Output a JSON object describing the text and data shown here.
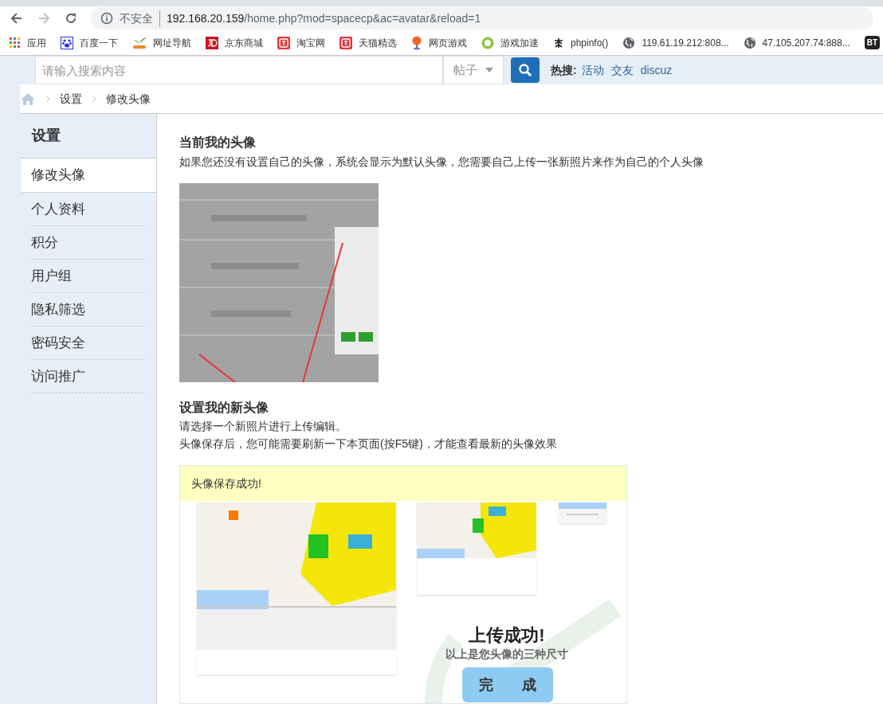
{
  "browser": {
    "security_label": "不安全",
    "url_host": "192.168.20.159",
    "url_path": "/home.php?mod=spacecp&ac=avatar&reload=1"
  },
  "bookmarks": [
    {
      "label": "应用",
      "kind": "apps"
    },
    {
      "label": "百度一下",
      "kind": "paw"
    },
    {
      "label": "网址导航",
      "kind": "leaf"
    },
    {
      "label": "京东商城",
      "kind": "jd"
    },
    {
      "label": "淘宝网",
      "kind": "tao"
    },
    {
      "label": "天猫精选",
      "kind": "tao"
    },
    {
      "label": "网页游戏",
      "kind": "pin"
    },
    {
      "label": "游戏加速",
      "kind": "ball"
    },
    {
      "label": "phpinfo()",
      "kind": "glyph"
    },
    {
      "label": "119.61.19.212:808...",
      "kind": "globe"
    },
    {
      "label": "47.105.207.74:888...",
      "kind": "globe"
    }
  ],
  "bookmark_end": "BT",
  "search": {
    "placeholder": "请输入搜索内容",
    "category": "帖子",
    "hot_label": "热搜:",
    "hot_links": [
      "活动",
      "交友",
      "discuz"
    ]
  },
  "breadcrumb": [
    "设置",
    "修改头像"
  ],
  "sidebar": {
    "title": "设置",
    "items": [
      {
        "label": "修改头像",
        "selected": true
      },
      {
        "label": "个人资料",
        "selected": false
      },
      {
        "label": "积分",
        "selected": false
      },
      {
        "label": "用户组",
        "selected": false
      },
      {
        "label": "隐私筛选",
        "selected": false
      },
      {
        "label": "密码安全",
        "selected": false
      },
      {
        "label": "访问推广",
        "selected": false
      }
    ]
  },
  "current": {
    "title": "当前我的头像",
    "text": "如果您还没有设置自己的头像，系统会显示为默认头像，您需要自己上传一张新照片来作为自己的个人头像"
  },
  "new_avatar": {
    "title": "设置我的新头像",
    "lines": [
      "请选择一个新照片进行上传编辑。",
      "头像保存后，您可能需要刷新一下本页面(按F5键)，才能查看最新的头像效果"
    ]
  },
  "upload": {
    "notice": "头像保存成功!",
    "success_title": "上传成功!",
    "success_subtitle": "以上是您头像的三种尺寸",
    "done_button": "完　　成"
  }
}
